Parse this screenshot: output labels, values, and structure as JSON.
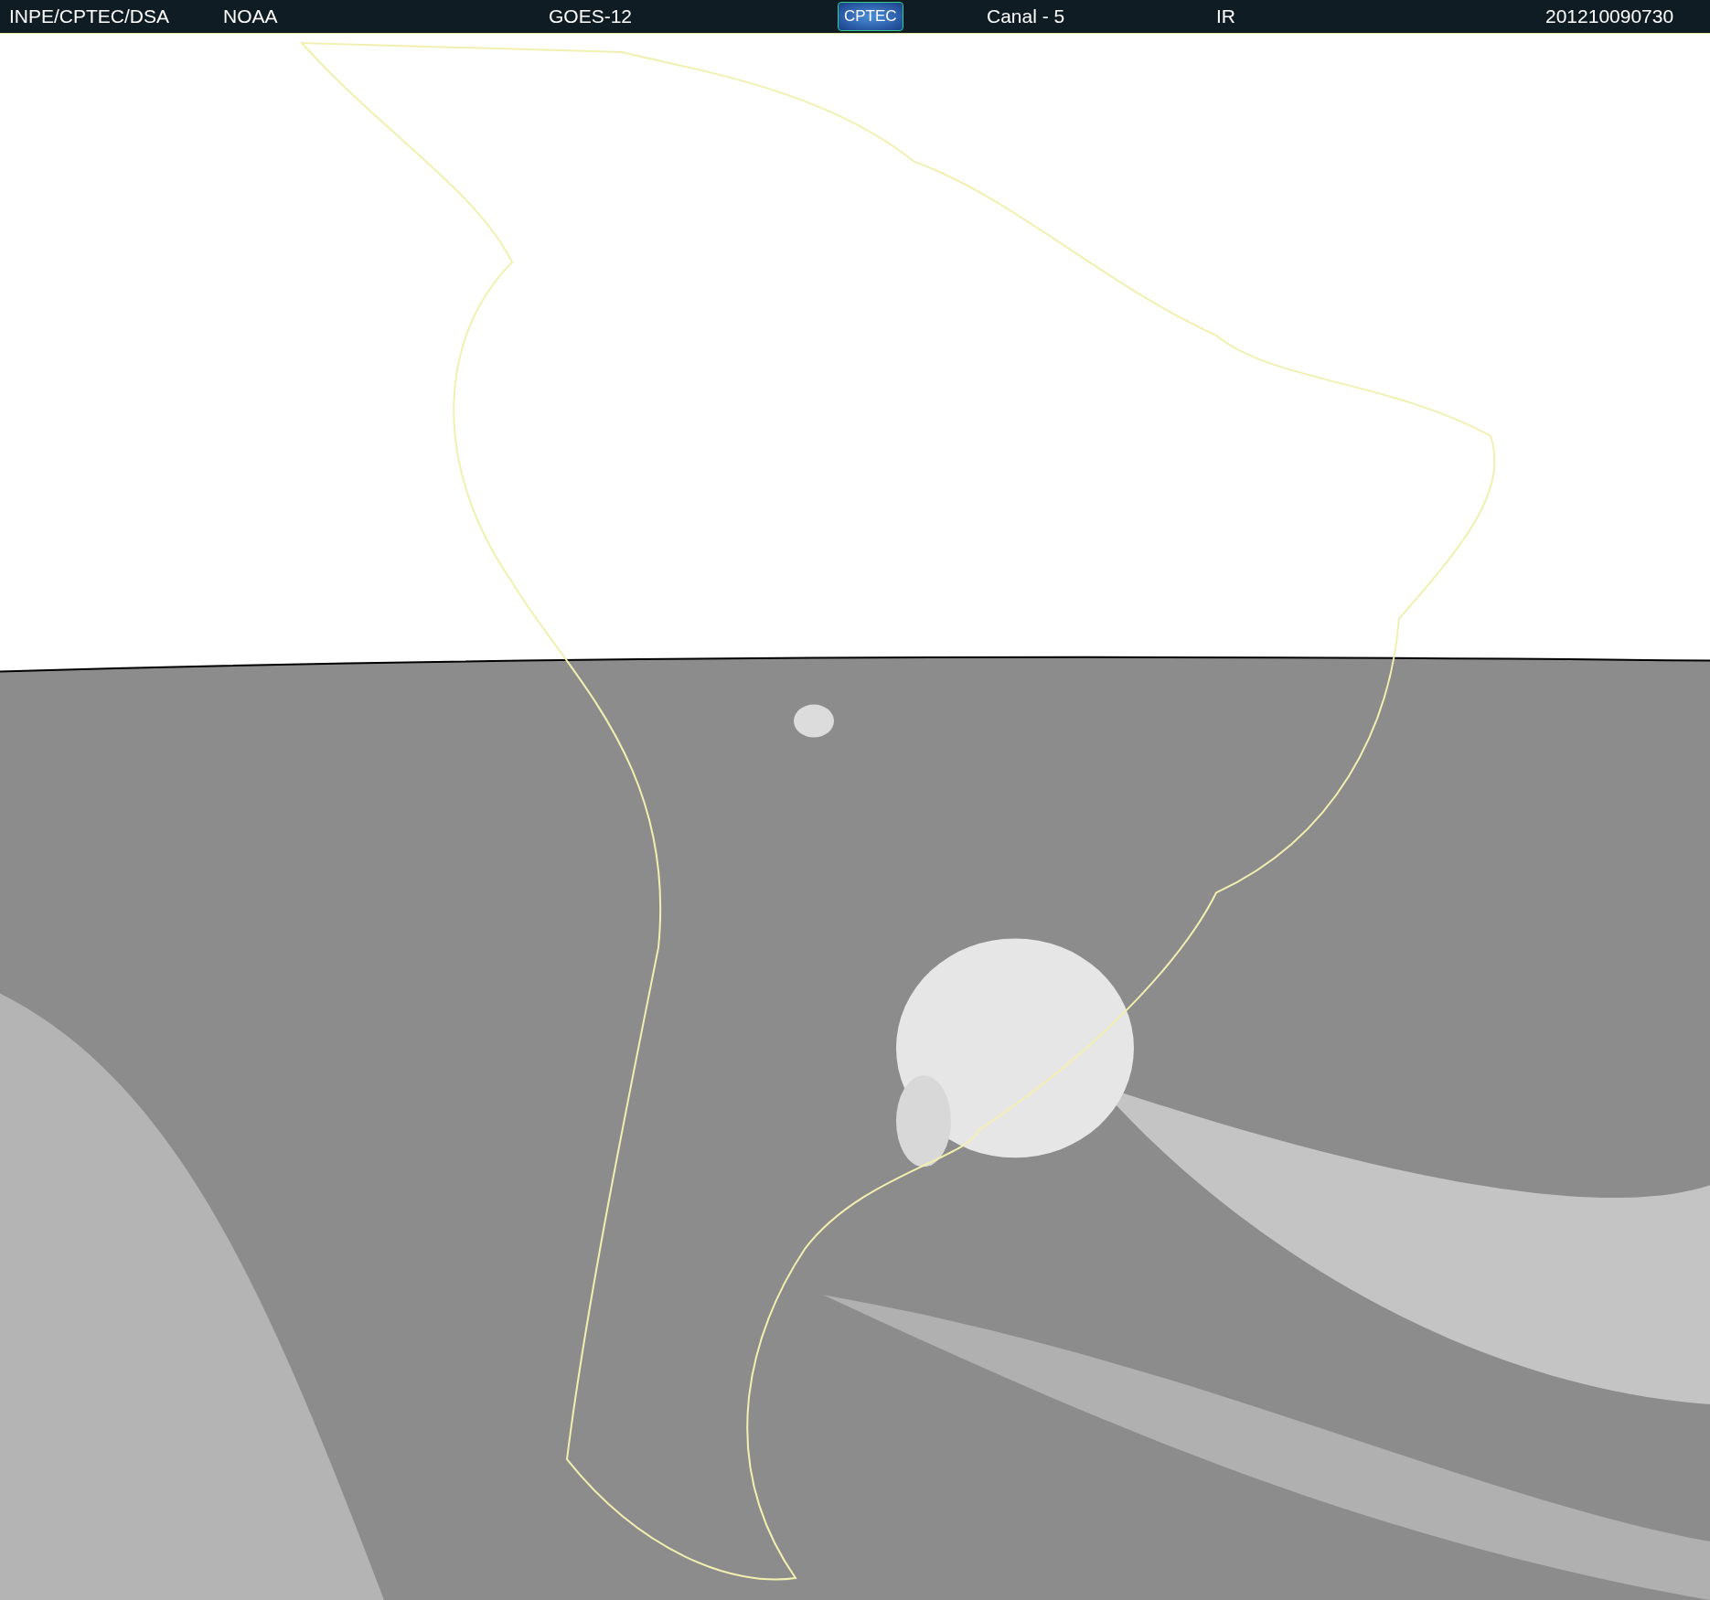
{
  "header": {
    "items": [
      {
        "kind": "text",
        "text": "INPE/CPTEC/DSA"
      },
      {
        "kind": "text",
        "text": "NOAA"
      },
      {
        "kind": "text",
        "text": "GOES-12"
      },
      {
        "kind": "logo",
        "text": "CPTEC"
      },
      {
        "kind": "text",
        "text": "Canal - 5"
      },
      {
        "kind": "text",
        "text": "IR"
      },
      {
        "kind": "text",
        "text": "201210090730"
      }
    ]
  }
}
